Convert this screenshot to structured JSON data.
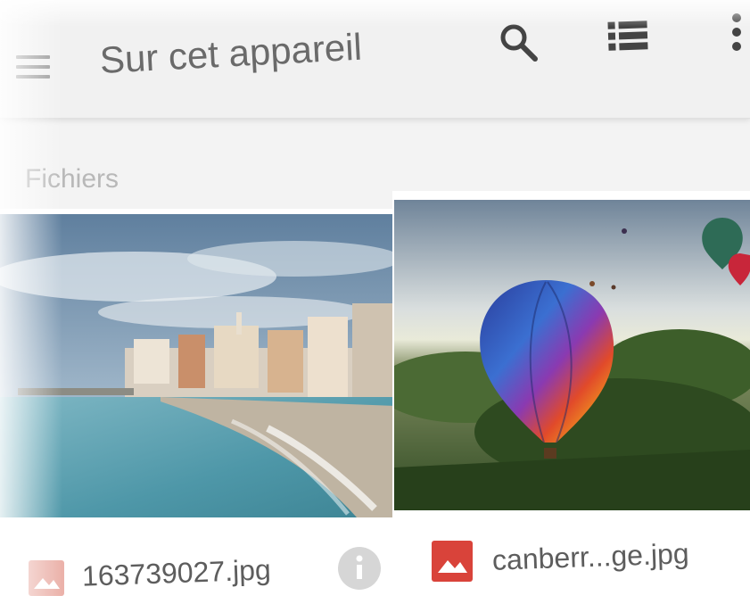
{
  "toolbar": {
    "title": "Sur cet appareil",
    "icons": [
      "menu-icon",
      "search-icon",
      "list-view-icon",
      "more-vert-icon"
    ]
  },
  "section": {
    "label": "Fichiers"
  },
  "files": [
    {
      "name": "163739027.jpg",
      "icon": "image-file-icon",
      "thumbnail": "coastal-town-beach"
    },
    {
      "name": "canberr...ge.jpg",
      "icon": "image-file-icon",
      "thumbnail": "hot-air-balloons"
    }
  ],
  "colors": {
    "toolbar_bg": "#f1f1f1",
    "title_text": "#6a6a6a",
    "image_icon_red": "#d9433a",
    "info_icon_gray": "#d6d6d6"
  }
}
